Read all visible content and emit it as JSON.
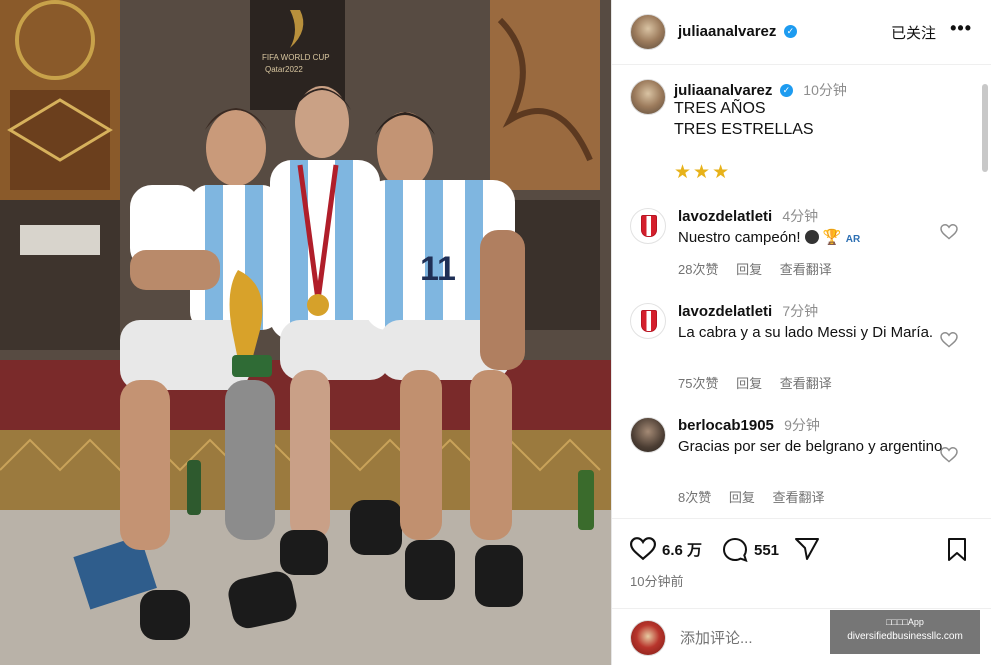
{
  "photo": {
    "banner_text_1": "FIFA WORLD CUP",
    "banner_text_2": "Qatar2022",
    "jersey_number": "11"
  },
  "header": {
    "username": "juliaanalvarez",
    "follow_label": "已关注",
    "more_label": "•••"
  },
  "caption": {
    "username": "juliaanalvarez",
    "time": "10分钟",
    "line1": "TRES AÑOS",
    "line2": "TRES ESTRELLAS",
    "stars": "★★★"
  },
  "comments": [
    {
      "username": "lavozdelatleti",
      "time": "4分钟",
      "text": "Nuestro campeón!",
      "flag": "AR",
      "likes": "28次赞",
      "reply": "回复",
      "translate": "查看翻译"
    },
    {
      "username": "lavozdelatleti",
      "time": "7分钟",
      "text": "La cabra y a su lado Messi y Di María.",
      "likes": "75次赞",
      "reply": "回复",
      "translate": "查看翻译"
    },
    {
      "username": "berlocab1905",
      "time": "9分钟",
      "text": "Gracias por ser de belgrano y argentino",
      "likes": "8次赞",
      "reply": "回复",
      "translate": "查看翻译"
    }
  ],
  "actions": {
    "likes_count": "6.6 万",
    "comments_count": "551",
    "post_time": "10分钟前"
  },
  "add_comment": {
    "placeholder": "添加评论..."
  },
  "watermark": {
    "line1": "□□□□App",
    "line2": "diversifiedbusinessllc.com"
  }
}
